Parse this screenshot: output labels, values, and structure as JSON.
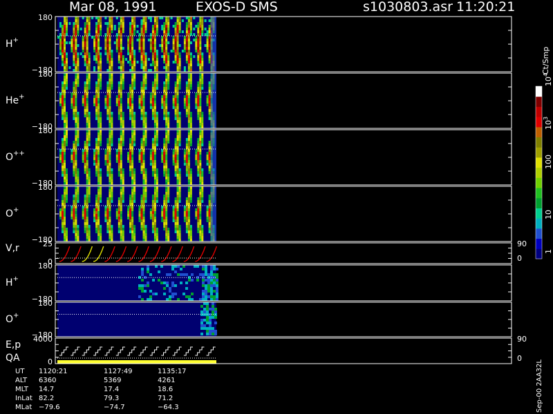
{
  "header": {
    "date": "Mar 08, 1991",
    "instrument": "EXOS-D SMS",
    "file": "s1030803.asr",
    "time": "11:20:21"
  },
  "colorbar": {
    "title": "Ct/Smp",
    "labels": [
      "1",
      "10",
      "100",
      "10",
      "10"
    ],
    "label_exponents": [
      "",
      "",
      "",
      "3",
      "4"
    ],
    "colors": [
      "#000080",
      "#0000c0",
      "#2050d0",
      "#00b0c0",
      "#00d090",
      "#00a030",
      "#20c020",
      "#70d000",
      "#b0d000",
      "#e0e000",
      "#a0a000",
      "#808000",
      "#c06000",
      "#e00000",
      "#c00000",
      "#800000",
      "#ffffff"
    ]
  },
  "panels": [
    {
      "id": "h-plus",
      "label_main": "H",
      "label_sup": "+",
      "top_tick": "180",
      "bottom_tick": "−180"
    },
    {
      "id": "he-plus",
      "label_main": "He",
      "label_sup": "+",
      "top_tick": "180",
      "bottom_tick": "−180"
    },
    {
      "id": "o-plus-plus",
      "label_main": "O",
      "label_sup": "++",
      "top_tick": "180",
      "bottom_tick": "−180"
    },
    {
      "id": "o-plus",
      "label_main": "O",
      "label_sup": "+",
      "top_tick": "180",
      "bottom_tick": "−180"
    },
    {
      "id": "vr",
      "label_main": "V,r",
      "label_sup": "",
      "top_tick": "25",
      "bottom_tick": "0",
      "right_top": "90",
      "right_bottom": "0"
    },
    {
      "id": "h-plus-2",
      "label_main": "H",
      "label_sup": "+",
      "top_tick": "180",
      "bottom_tick": "−180"
    },
    {
      "id": "o-plus-2",
      "label_main": "O",
      "label_sup": "+",
      "top_tick": "180",
      "bottom_tick": "−180"
    },
    {
      "id": "ep-qa",
      "label_main": "E,p",
      "label_line2": "QA",
      "label_sup": "",
      "top_tick": "4000",
      "bottom_tick": "0",
      "right_top": "90",
      "right_bottom": "0"
    }
  ],
  "footer": {
    "rows": [
      {
        "name": "UT",
        "values": [
          "1120:21",
          "1127:49",
          "1135:17"
        ]
      },
      {
        "name": "ALT",
        "values": [
          "6360",
          "5369",
          "4261"
        ]
      },
      {
        "name": "MLT",
        "values": [
          "14.7",
          "17.4",
          "18.6"
        ]
      },
      {
        "name": "InLat",
        "values": [
          "82.2",
          "79.3",
          "71.2"
        ]
      },
      {
        "name": "MLat",
        "values": [
          "−79.6",
          "−74.7",
          "−64.3"
        ]
      }
    ],
    "side_note": "Sep-00 2AA32L"
  },
  "chart_data": {
    "type": "heatmap",
    "panels": [
      "H+",
      "He+",
      "O++",
      "O+",
      "V,r",
      "H+",
      "O+",
      "E,p / QA"
    ],
    "pitch_angle_range": [
      -180,
      180
    ],
    "colorbar_scale": "log",
    "colorbar_range": [
      1,
      10000
    ],
    "ut_ticks": [
      "1120:21",
      "1127:49",
      "1135:17"
    ],
    "sweep_count": 14,
    "data_coverage": "first sweeps only; remainder of interval blank"
  }
}
